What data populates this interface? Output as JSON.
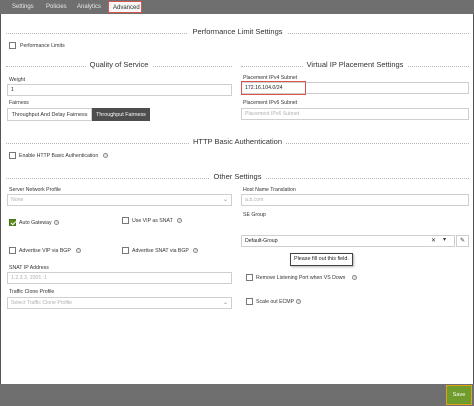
{
  "tabs": [
    "Settings",
    "Policies",
    "Analytics",
    "Advanced"
  ],
  "sections": {
    "performance": "Performance Limit Settings",
    "qos": "Quality of Service",
    "vip": "Virtual IP Placement Settings",
    "http": "HTTP Basic Authentication",
    "other": "Other Settings"
  },
  "performance_limits_label": "Performance Limits",
  "weight": {
    "label": "Weight",
    "value": "1"
  },
  "fairness": {
    "label": "Fairness",
    "options": [
      "Throughput And Delay Fairness",
      "Throughput Fairness"
    ],
    "selected": "Throughput Fairness"
  },
  "placement_ipv4": {
    "label": "Placement IPv4 Subnet",
    "value": "172.16.104.0/24"
  },
  "placement_ipv6": {
    "label": "Placement IPv6 Subnet",
    "placeholder": "Placement IPv6 Subnet"
  },
  "http_auth_label": "Enable HTTP Basic Authentication",
  "server_network_profile": {
    "label": "Server Network Profile",
    "value": "None"
  },
  "host_name_translation": {
    "label": "Host Name Translation",
    "placeholder": "a.b.com"
  },
  "checkboxes": {
    "auto_gateway": "Auto Gateway",
    "use_vip_snat": "Use VIP as SNAT",
    "advertise_vip_bgp": "Advertise VIP via BGP",
    "advertise_snat_bgp": "Advertise SNAT via BGP",
    "remove_listening_port": "Remove Listening Port when VS Down",
    "scale_out_ecmp": "Scale out ECMP"
  },
  "se_group": {
    "label": "SE Group",
    "value": "Default-Group"
  },
  "tooltip": "Please fill out this field.",
  "snat_ip": {
    "label": "SNAT IP Address",
    "placeholder": "1.2.3.3, 2001::1"
  },
  "traffic_clone": {
    "label": "Traffic Clone Profile",
    "placeholder": "Select Traffic Clone Profile"
  },
  "save_label": "Save",
  "colors": {
    "accent_green": "#5a8d1e",
    "highlight_red": "#d9534f",
    "save_border": "#e0a21a"
  }
}
